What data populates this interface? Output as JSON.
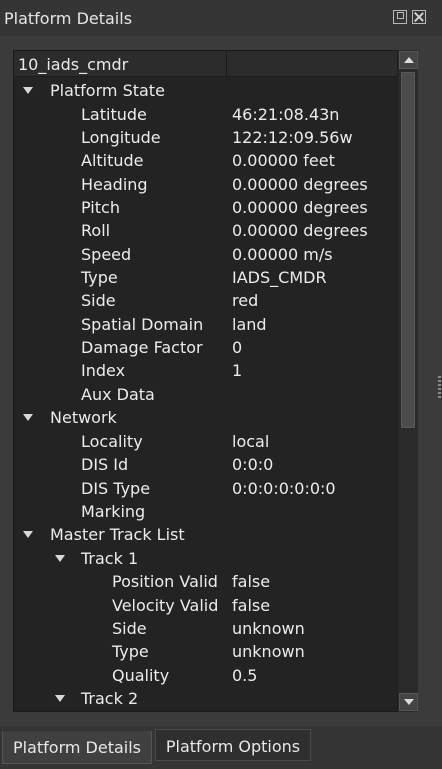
{
  "window": {
    "title": "Platform Details"
  },
  "tree": {
    "header": "10_iads_cmdr",
    "rows": [
      {
        "label": "Platform State",
        "value": "",
        "expandable": true
      },
      {
        "label": "Latitude",
        "value": "46:21:08.43n"
      },
      {
        "label": "Longitude",
        "value": "122:12:09.56w"
      },
      {
        "label": "Altitude",
        "value": "0.00000 feet"
      },
      {
        "label": "Heading",
        "value": "0.00000 degrees"
      },
      {
        "label": "Pitch",
        "value": "0.00000 degrees"
      },
      {
        "label": "Roll",
        "value": "0.00000 degrees"
      },
      {
        "label": "Speed",
        "value": "0.00000 m/s"
      },
      {
        "label": "Type",
        "value": "IADS_CMDR"
      },
      {
        "label": "Side",
        "value": "red"
      },
      {
        "label": "Spatial Domain",
        "value": "land"
      },
      {
        "label": "Damage Factor",
        "value": "0"
      },
      {
        "label": "Index",
        "value": "1"
      },
      {
        "label": "Aux Data",
        "value": ""
      },
      {
        "label": "Network",
        "value": "",
        "expandable": true
      },
      {
        "label": "Locality",
        "value": "local"
      },
      {
        "label": "DIS Id",
        "value": "0:0:0"
      },
      {
        "label": "DIS Type",
        "value": "0:0:0:0:0:0:0"
      },
      {
        "label": "Marking",
        "value": ""
      },
      {
        "label": "Master Track List",
        "value": "",
        "expandable": true
      },
      {
        "label": "Track 1",
        "value": "",
        "expandable": true
      },
      {
        "label": "Position Valid",
        "value": "false"
      },
      {
        "label": "Velocity Valid",
        "value": "false"
      },
      {
        "label": "Side",
        "value": "unknown"
      },
      {
        "label": "Type",
        "value": "unknown"
      },
      {
        "label": "Quality",
        "value": "0.5"
      },
      {
        "label": "Track 2",
        "value": "",
        "expandable": true
      }
    ]
  },
  "tabs": [
    {
      "label": "Platform Details",
      "active": true
    },
    {
      "label": "Platform Options",
      "active": false
    }
  ]
}
